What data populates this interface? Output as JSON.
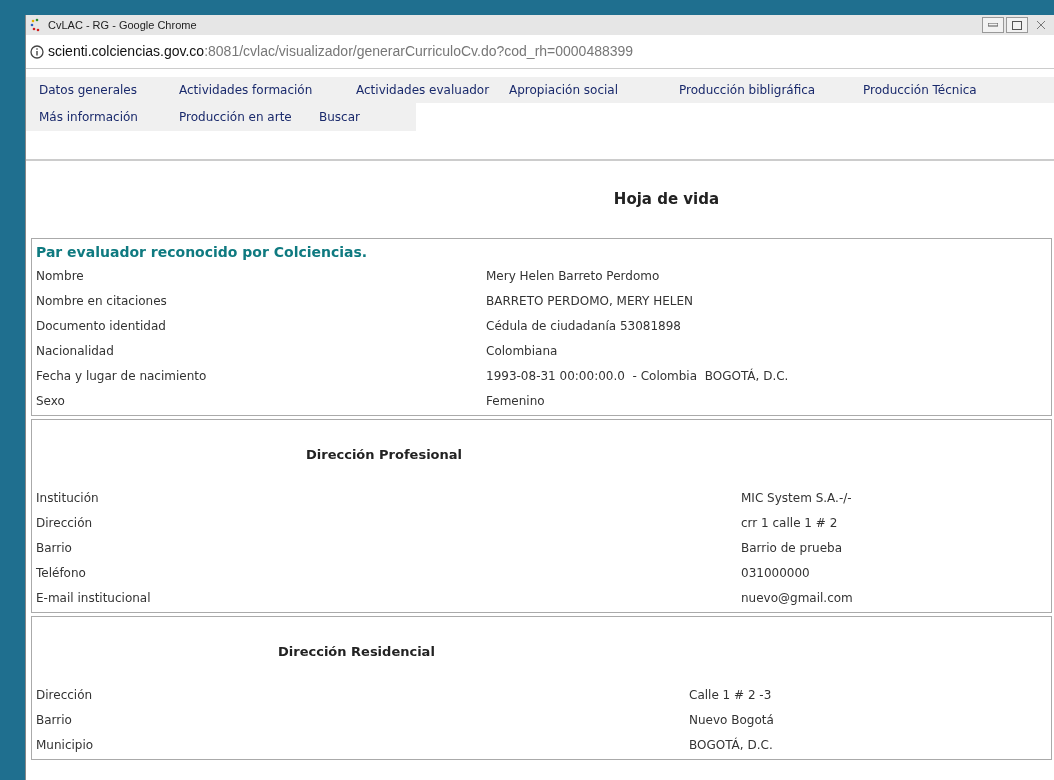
{
  "window": {
    "title": "CvLAC - RG - Google Chrome"
  },
  "address_bar": {
    "host": "scienti.colciencias.gov.co",
    "path": ":8081/cvlac/visualizador/generarCurriculoCv.do?cod_rh=0000488399"
  },
  "nav_rows": [
    [
      "Datos generales",
      "Actividades formación",
      "Actividades evaluador",
      "Apropiación social",
      "Producción bibligráfica",
      "Producción Técnica"
    ],
    [
      "Más información",
      "Producción en arte",
      "Buscar"
    ]
  ],
  "page_title": "Hoja de vida",
  "sections": [
    {
      "kind": "intro",
      "heading": "Par evaluador reconocido por Colciencias.",
      "rows": [
        {
          "label": "Nombre",
          "value": "Mery Helen Barreto Perdomo"
        },
        {
          "label": "Nombre en citaciones",
          "value": "BARRETO PERDOMO, MERY HELEN"
        },
        {
          "label": "Documento identidad",
          "value": "Cédula de ciudadanía 53081898"
        },
        {
          "label": "Nacionalidad",
          "value": "Colombiana"
        },
        {
          "label": "Fecha y lugar de nacimiento",
          "value": "1993-08-31 00:00:00.0  - Colombia  BOGOTÁ, D.C."
        },
        {
          "label": "Sexo",
          "value": "Femenino"
        }
      ]
    },
    {
      "kind": "professional",
      "heading": "Dirección Profesional",
      "rows": [
        {
          "label": "Institución",
          "value": "MIC System S.A.-/-"
        },
        {
          "label": "Dirección",
          "value": "crr 1 calle 1 # 2"
        },
        {
          "label": "Barrio",
          "value": "Barrio de prueba"
        },
        {
          "label": "Teléfono",
          "value": "031000000"
        },
        {
          "label": "E-mail institucional",
          "value": "nuevo@gmail.com"
        }
      ]
    },
    {
      "kind": "residential",
      "heading": "Dirección Residencial",
      "rows": [
        {
          "label": "Dirección",
          "value": "Calle 1 # 2 -3"
        },
        {
          "label": "Barrio",
          "value": "Nuevo Bogotá"
        },
        {
          "label": "Municipio",
          "value": "BOGOTÁ, D.C."
        }
      ]
    }
  ]
}
